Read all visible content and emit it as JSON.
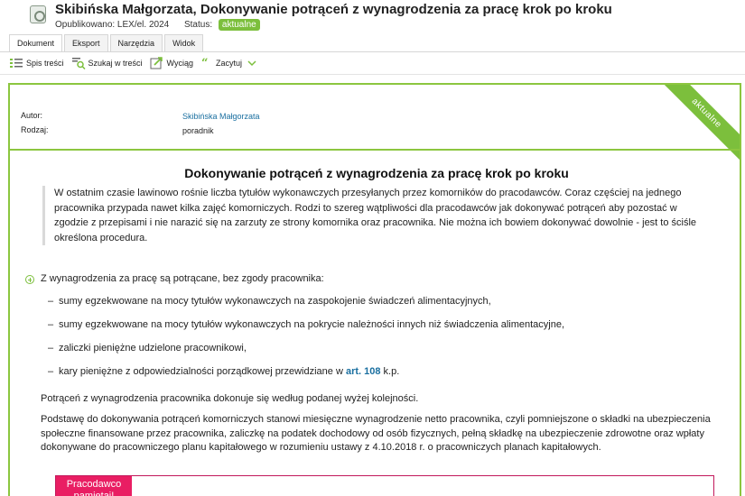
{
  "header": {
    "title": "Skibińska Małgorzata, Dokonywanie potrąceń z wynagrodzenia za pracę krok po kroku",
    "published": "Opublikowano: LEX/el. 2024",
    "status_label": "Status:",
    "status_value": "aktualne"
  },
  "tabs": [
    {
      "label": "Dokument"
    },
    {
      "label": "Eksport"
    },
    {
      "label": "Narzędzia"
    },
    {
      "label": "Widok"
    }
  ],
  "toolbar": {
    "toc": "Spis treści",
    "search": "Szukaj w treści",
    "extract": "Wyciąg",
    "quote": "Zacytuj"
  },
  "ribbon": "aktualne",
  "meta": {
    "author_label": "Autor:",
    "author_value": "Skibińska Małgorzata",
    "type_label": "Rodzaj:",
    "type_value": "poradnik"
  },
  "content": {
    "title": "Dokonywanie potrąceń z wynagrodzenia za pracę krok po kroku",
    "lead": "W ostatnim czasie lawinowo rośnie liczba tytułów wykonawczych przesyłanych przez komorników do pracodawców. Coraz częściej na jednego pracownika przypada nawet kilka zajęć komorniczych. Rodzi to szereg wątpliwości dla pracodawców jak dokonywać potrąceń aby pozostać w zgodzie z przepisami i nie narazić się na zarzuty ze strony komornika oraz pracownika. Nie można ich bowiem dokonywać dowolnie - jest to ściśle określona procedura.",
    "lead_in": "Z wynagrodzenia za pracę są potrącane, bez zgody pracownika:",
    "bullets": [
      "sumy egzekwowane na mocy tytułów wykonawczych na zaspokojenie świadczeń alimentacyjnych,",
      "sumy egzekwowane na mocy tytułów wykonawczych na pokrycie należności innych niż świadczenia alimentacyjne,",
      "zaliczki pieniężne udzielone pracownikowi,"
    ],
    "last_bullet_prefix": "kary pieniężne z odpowiedzialności porządkowej przewidziane w ",
    "last_bullet_link": "art. 108",
    "last_bullet_suffix": " k.p.",
    "para1": "Potrąceń z wynagrodzenia pracownika dokonuje się według podanej wyżej kolejności.",
    "para2": "Podstawę do dokonywania potrąceń komorniczych stanowi miesięczne wynagrodzenie netto pracownika, czyli pomniejszone o składki na ubezpieczenia społeczne finansowane przez pracownika, zaliczkę na podatek dochodowy od osób fizycznych, pełną składkę na ubezpieczenie zdrowotne oraz wpłaty dokonywane do pracowniczego planu kapitałowego w rozumieniu ustawy z 4.10.2018 r. o pracowniczych planach kapitałowych.",
    "box_label": "Pracodawco pamiętaj!"
  },
  "colors": {
    "accent_green": "#8cc63f",
    "link_blue": "#1a6fa0",
    "box_magenta": "#e91e63"
  }
}
